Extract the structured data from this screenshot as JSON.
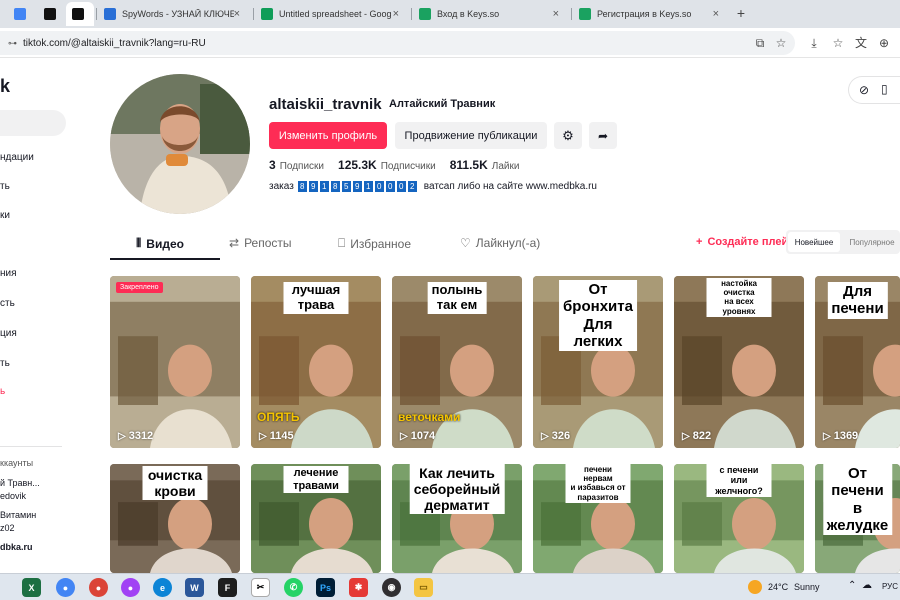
{
  "browser": {
    "tabs": [
      {
        "title": "",
        "icon": "docs-icon",
        "color": "#4285f4"
      },
      {
        "title": "",
        "icon": "tiktok-icon",
        "color": "#111111"
      },
      {
        "title": "",
        "icon": "tiktok-icon",
        "color": "#111111"
      },
      {
        "title": "SpyWords - УЗНАЙ КЛЮЧЕВЫЕ",
        "icon": "spywords-icon",
        "color": "#2a6fd6"
      },
      {
        "title": "Untitled spreadsheet - Google S",
        "icon": "sheets-icon",
        "color": "#0f9d58"
      },
      {
        "title": "Вход в Keys.so",
        "icon": "keys-icon",
        "color": "#1aa260"
      },
      {
        "title": "Регистрация в Keys.so",
        "icon": "keys-icon",
        "color": "#1aa260"
      }
    ],
    "new_tab": "+",
    "url": "tiktok.com/@altaiskii_travnik?lang=ru-RU"
  },
  "sidebar": {
    "logo": "k",
    "items": [
      "ндации",
      "ть",
      "ки",
      "ния",
      "сть",
      "ция",
      "ть",
      "ь"
    ],
    "accounts_heading": "ккаунты",
    "accounts": [
      "й Травн...",
      "edovik",
      "Витамин",
      "z02",
      "dbka.ru"
    ]
  },
  "profile": {
    "username": "altaiskii_travnik",
    "display_name": "Алтайский Травник",
    "edit_button": "Изменить профиль",
    "promote_button": "Продвижение публикации",
    "stats": [
      {
        "value": "3",
        "label": "Подписки"
      },
      {
        "value": "125.3K",
        "label": "Подписчики"
      },
      {
        "value": "811.5K",
        "label": "Лайки"
      }
    ],
    "bio_prefix": "заказ",
    "bio_digits": [
      "8",
      "9",
      "1",
      "8",
      "5",
      "9",
      "1",
      "0",
      "0",
      "0",
      "2"
    ],
    "bio_suffix": "ватсап либо на сайте www.medbka.ru"
  },
  "content_tabs": {
    "videos": "Видео",
    "reposts": "Репосты",
    "favorites": "Избранное",
    "liked": "Лайкнул(-а)",
    "create_playlist": "Создайте плейлист",
    "sort_latest": "Новейшее",
    "sort_popular": "Популярное"
  },
  "videos": [
    {
      "badge": "Закреплено",
      "caption": "",
      "views": "3312",
      "overlay": "",
      "overlay_color": ""
    },
    {
      "badge": "",
      "caption": "лучшая трава",
      "views": "1145",
      "overlay": "ОПЯТЬ",
      "overlay_color": "#f5c400"
    },
    {
      "badge": "",
      "caption": "полынь\nтак ем",
      "views": "1074",
      "overlay": "веточками",
      "overlay_color": "#f5c400"
    },
    {
      "badge": "",
      "caption": "От бронхита\nДля легких",
      "views": "326",
      "overlay": "",
      "overlay_color": ""
    },
    {
      "badge": "",
      "caption": "настойка очистка\nна всех уровнях",
      "views": "822",
      "overlay": "",
      "overlay_color": ""
    },
    {
      "badge": "",
      "caption": "Для печени",
      "views": "1369",
      "overlay": "",
      "overlay_color": ""
    },
    {
      "badge": "",
      "caption": "очистка крови",
      "views": "",
      "overlay": "",
      "overlay_color": ""
    },
    {
      "badge": "",
      "caption": "лечение травами",
      "views": "",
      "overlay": "",
      "overlay_color": ""
    },
    {
      "badge": "",
      "caption": "Как лечить\nсеборейный\nдерматит",
      "views": "",
      "overlay": "",
      "overlay_color": ""
    },
    {
      "badge": "",
      "caption": "печени\nнервам\nи избавься от паразитов",
      "views": "",
      "overlay": "",
      "overlay_color": ""
    },
    {
      "badge": "",
      "caption": "с печени или желчного?",
      "views": "",
      "overlay": "",
      "overlay_color": ""
    },
    {
      "badge": "",
      "caption": "От печени\nв желудке",
      "views": "",
      "overlay": "",
      "overlay_color": ""
    }
  ],
  "taskbar": {
    "weather_temp": "24°C",
    "weather_text": "Sunny",
    "language": "РУС"
  },
  "colors": {
    "accent": "#fe2c55",
    "digit_box": "#1565c0"
  }
}
